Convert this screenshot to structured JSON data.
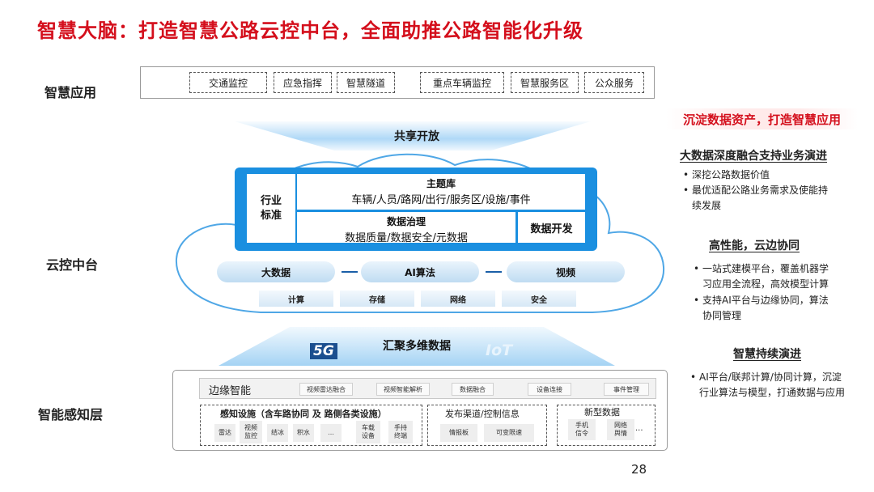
{
  "title": "智慧大脑：打造智慧公路云控中台，全面助推公路智能化升级",
  "layers": {
    "app": "智慧应用",
    "cloud": "云控中台",
    "perception": "智能感知层"
  },
  "apps": [
    "交通监控",
    "应急指挥",
    "智慧隧道",
    "重点车辆监控",
    "智慧服务区",
    "公众服务"
  ],
  "share_open": "共享开放",
  "core": {
    "industry_line1": "行业",
    "industry_line2": "标准",
    "theme_title": "主题库",
    "theme_items": "车辆/人员/路网/出行/服务区/设施/事件",
    "gov_title": "数据治理",
    "gov_items": "数据质量/数据安全/元数据",
    "dev": "数据开发"
  },
  "pills": [
    "大数据",
    "AI算法",
    "视频"
  ],
  "resources": [
    "计算",
    "存储",
    "网络",
    "安全"
  ],
  "aggregate": "汇聚多维数据",
  "logos": {
    "g5": "5G",
    "iot": "IoT"
  },
  "edge": {
    "title": "边缘智能",
    "chips": [
      "视频雷达融合",
      "视频智能解析",
      "数据融合",
      "设备连接",
      "事件管理"
    ]
  },
  "sensing": {
    "title": "感知设施（含车路协同 及 路侧各类设施）",
    "items": [
      [
        "雷达"
      ],
      [
        "视频",
        "监控"
      ],
      [
        "结冰"
      ],
      [
        "积水"
      ],
      [
        "..."
      ],
      [
        "车载",
        "设备"
      ],
      [
        "手持",
        "终端"
      ]
    ]
  },
  "publish": {
    "title": "发布渠道/控制信息",
    "items": [
      "情报板",
      "可变限速"
    ]
  },
  "newdata": {
    "title": "新型数据",
    "items": [
      [
        "手机",
        "信令"
      ],
      [
        "网络",
        "舆情"
      ]
    ],
    "more": "..."
  },
  "right": {
    "headline": "沉淀数据资产，打造智慧应用",
    "sections": [
      {
        "title": "大数据深度融合支持业务演进",
        "bullets": [
          [
            "深挖公路数据价值"
          ],
          [
            "最优适配公路业务需求及使能持",
            "续发展"
          ]
        ]
      },
      {
        "title": "高性能，云边协同",
        "bullets": [
          [
            "一站式建模平台，覆盖机器学",
            "习应用全流程，高效模型计算"
          ],
          [
            "支持AI平台与边缘协同，算法",
            "协同管理"
          ]
        ]
      },
      {
        "title": "智慧持续演进",
        "bullets": [
          [
            "AI平台/联邦计算/协同计算，沉淀",
            "行业算法与模型，打通数据与应用"
          ]
        ]
      }
    ]
  },
  "bullet_char": "•",
  "page_number": "28",
  "colors": {
    "accent_red": "#d40f1c",
    "core_blue": "#1a8fe0",
    "connector": "#1a5fa8"
  }
}
